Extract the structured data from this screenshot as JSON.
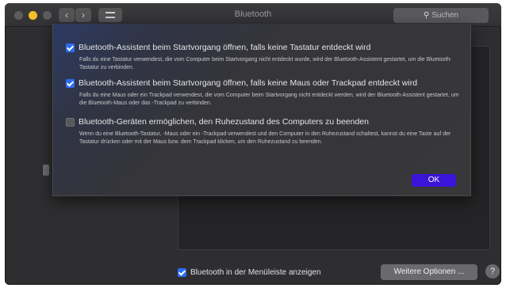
{
  "window": {
    "title": "Bluetooth",
    "search_placeholder": "Suchen",
    "icons": {
      "back": "chevron-left-icon",
      "forward": "chevron-right-icon",
      "grid": "grid-icon",
      "search": "search-icon"
    }
  },
  "sheet": {
    "options": [
      {
        "checked": true,
        "label": "Bluetooth-Assistent beim Startvorgang öffnen, falls keine Tastatur entdeckt wird",
        "description": "Falls du eine Tastatur verwendest, die vom Computer beim Startvorgang nicht entdeckt wurde, wird der Bluetooth-Assistent gestartet, um die Bluetooth-Tastatur zu verbinden."
      },
      {
        "checked": true,
        "label": "Bluetooth-Assistent beim Startvorgang öffnen, falls keine Maus oder Trackpad entdeckt wird",
        "description": "Falls du eine Maus oder ein Trackpad verwendest, die vom Computer beim Startvorgang nicht entdeckt werden, wird der Bluetooth-Assistent gestartet, um die Bluetooth-Maus oder das -Trackpad zu verbinden."
      },
      {
        "checked": false,
        "label": "Bluetooth-Geräten ermöglichen, den Ruhezustand des Computers zu beenden",
        "description": "Wenn du eine Bluetooth-Tastatur, -Maus oder ein -Trackpad verwendest und den Computer in den Ruhezustand schaltest, kannst du eine Taste auf der Tastatur drücken oder mit der Maus bzw. dem Trackpad klicken, um den Ruhezustand zu beenden."
      }
    ],
    "ok_label": "OK"
  },
  "bottom": {
    "menu_checkbox_checked": true,
    "menu_checkbox_label": "Bluetooth in der Menüleiste anzeigen",
    "more_options_label": "Weitere Optionen ...",
    "help_label": "?"
  },
  "colors": {
    "accent": "#2d6cf5",
    "ok_button": "#3a14d8",
    "traffic_minimize": "#f5bd2b"
  }
}
